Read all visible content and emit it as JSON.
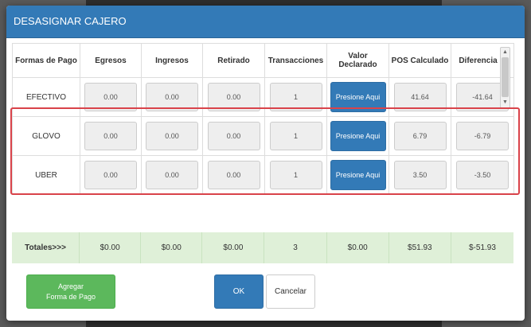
{
  "dialog": {
    "title": "DESASIGNAR CAJERO"
  },
  "table": {
    "headers": [
      "Formas de Pago",
      "Egresos",
      "Ingresos",
      "Retirado",
      "Transacciones",
      "Valor Declarado",
      "POS Calculado",
      "Diferencia"
    ],
    "button_label": "Presione Aqui",
    "rows": [
      {
        "forma": "EFECTIVO",
        "egresos": "0.00",
        "ingresos": "0.00",
        "retirado": "0.00",
        "transacciones": "1",
        "pos": "41.64",
        "diferencia": "-41.64"
      },
      {
        "forma": "GLOVO",
        "egresos": "0.00",
        "ingresos": "0.00",
        "retirado": "0.00",
        "transacciones": "1",
        "pos": "6.79",
        "diferencia": "-6.79"
      },
      {
        "forma": "UBER",
        "egresos": "0.00",
        "ingresos": "0.00",
        "retirado": "0.00",
        "transacciones": "1",
        "pos": "3.50",
        "diferencia": "-3.50"
      }
    ]
  },
  "totals": {
    "label": "Totales>>>",
    "egresos": "$0.00",
    "ingresos": "$0.00",
    "retirado": "$0.00",
    "transacciones": "3",
    "declarado": "$0.00",
    "pos": "$51.93",
    "diferencia": "$-51.93"
  },
  "footer": {
    "add_line1": "Agregar",
    "add_line2": "Forma de Pago",
    "ok": "OK",
    "cancel": "Cancelar"
  },
  "colors": {
    "header": "#337ab7",
    "totals_bg": "#dff0d8",
    "highlight": "#d9434a",
    "add_button": "#5cb85c"
  },
  "icons": [
    "scroll-up-arrow-icon",
    "scroll-down-arrow-icon"
  ]
}
